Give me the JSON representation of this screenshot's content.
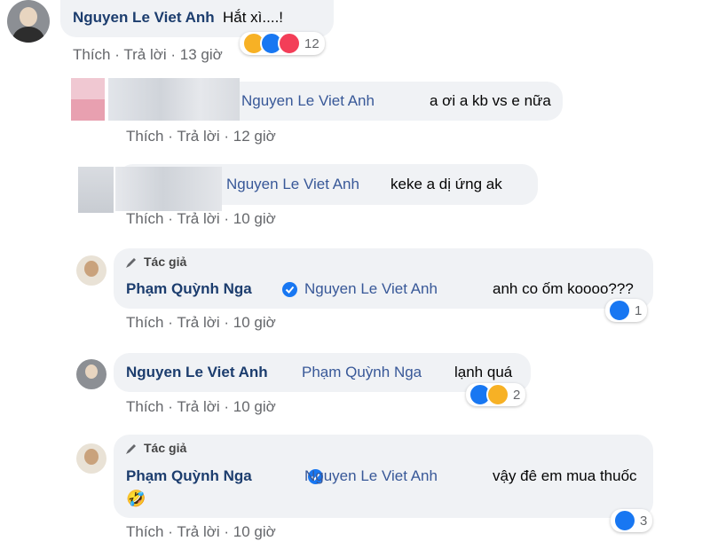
{
  "actions": {
    "like": "Thích",
    "reply": "Trả lời",
    "sep": "·"
  },
  "author_tag": "Tác giả",
  "comments": [
    {
      "name": "Nguyen Le Viet Anh",
      "text": "Hắt xì....!",
      "time": "13 giờ",
      "reactions": "12"
    },
    {
      "mention": "Nguyen Le Viet Anh",
      "text": "a ơi a kb vs e nữa",
      "time": "12 giờ"
    },
    {
      "mention": "Nguyen Le Viet Anh",
      "text": "keke a dị ứng ak",
      "time": "10 giờ"
    },
    {
      "name": "Phạm Quỳnh Nga",
      "mention": "Nguyen Le Viet Anh",
      "text": "anh co ốm koooo???",
      "time": "10 giờ",
      "reactions": "1"
    },
    {
      "name": "Nguyen Le Viet Anh",
      "mention": "Phạm Quỳnh Nga",
      "text": "lạnh quá",
      "time": "10 giờ",
      "reactions": "2"
    },
    {
      "name": "Phạm Quỳnh Nga",
      "mention": "Nguyen Le Viet Anh",
      "text": "vậy đê em mua thuốc",
      "emoji": "🤣",
      "time": "10 giờ",
      "reactions": "3"
    }
  ],
  "colors": {
    "like": "#1877f2",
    "haha": "#f7b125",
    "love": "#f33e58",
    "bubble": "#f0f2f5"
  }
}
